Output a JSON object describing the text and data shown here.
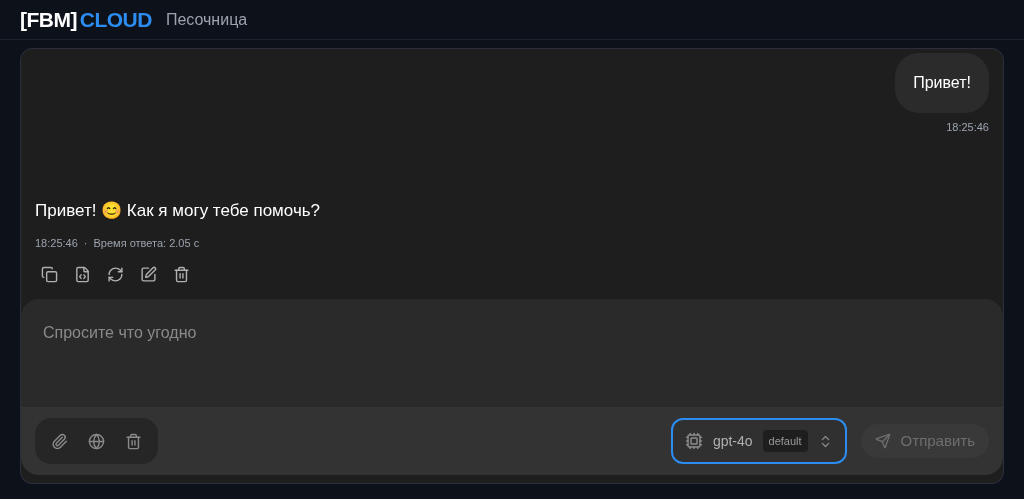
{
  "header": {
    "logo": [
      "[FBM]",
      "CLOUD"
    ],
    "title": "Песочница"
  },
  "messages": [
    {
      "kind": "user",
      "text": "Привет!",
      "time": "18:25:46"
    },
    {
      "kind": "assistant",
      "text": "Привет! 😊 Как я могу тебе помочь?",
      "time": "18:25:46",
      "separator": "·",
      "response_time": "Время ответа: 2.05 с",
      "actions": [
        {
          "kind": "copy"
        },
        {
          "kind": "code"
        },
        {
          "kind": "regenerate"
        },
        {
          "kind": "edit"
        },
        {
          "kind": "delete"
        }
      ]
    }
  ],
  "composer": {
    "placeholder": "Спросите что угодно",
    "tools": [
      {
        "kind": "attach"
      },
      {
        "kind": "web"
      },
      {
        "kind": "delete"
      }
    ],
    "model": {
      "name": "gpt-4o",
      "badge": "default",
      "focused": true
    },
    "send": {
      "label": "Отправить",
      "disabled": true
    }
  }
}
